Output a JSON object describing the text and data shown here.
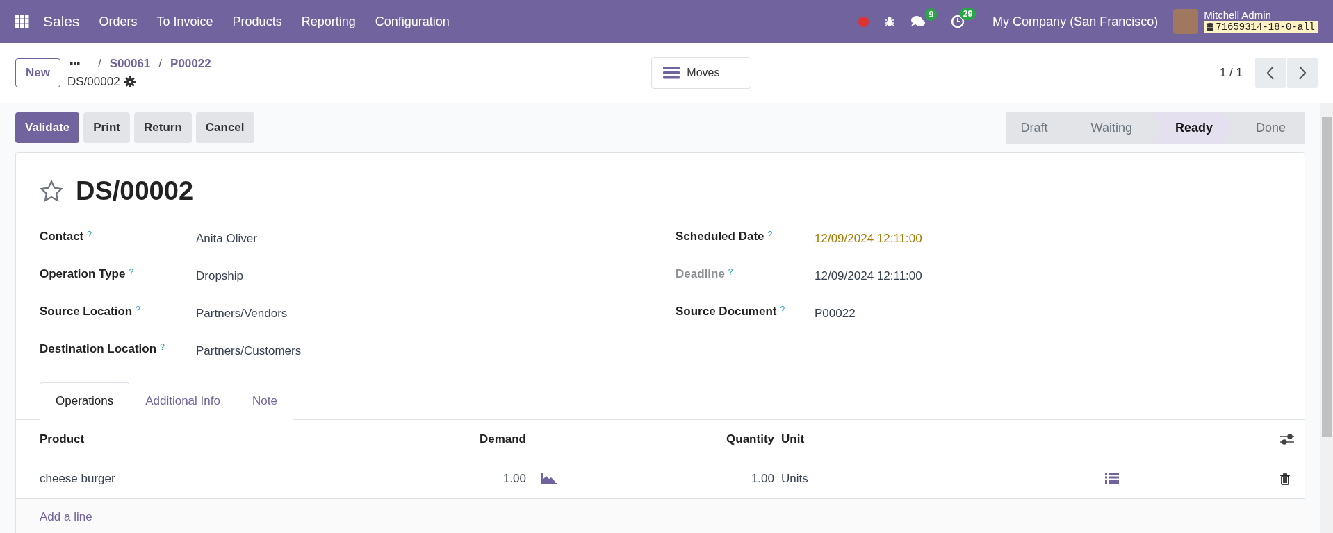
{
  "navbar": {
    "app": "Sales",
    "menus": [
      "Orders",
      "To Invoice",
      "Products",
      "Reporting",
      "Configuration"
    ],
    "messages_count": "9",
    "activities_count": "29",
    "company": "My Company (San Francisco)",
    "user": "Mitchell Admin",
    "database": "71659314-18-0-all"
  },
  "control_panel": {
    "new_button": "New",
    "breadcrumbs": [
      {
        "separator": "/",
        "label": "S00061"
      },
      {
        "separator": "/",
        "label": "P00022"
      }
    ],
    "record": "DS/00002",
    "moves_button": "Moves",
    "pager": "1 / 1"
  },
  "actions": [
    {
      "label": "Validate",
      "kind": "primary"
    },
    {
      "label": "Print",
      "kind": "secondary"
    },
    {
      "label": "Return",
      "kind": "secondary"
    },
    {
      "label": "Cancel",
      "kind": "secondary"
    }
  ],
  "stages": [
    {
      "label": "Draft",
      "selected": false
    },
    {
      "label": "Waiting",
      "selected": false
    },
    {
      "label": "Ready",
      "selected": true
    },
    {
      "label": "Done",
      "selected": false
    }
  ],
  "form": {
    "title": "DS/00002",
    "starred": false,
    "left_fields": [
      {
        "label": "Contact",
        "help": "?",
        "value": "Anita Oliver",
        "muted": false,
        "warning": false
      },
      {
        "label": "Operation Type",
        "help": "?",
        "value": "Dropship",
        "muted": false,
        "warning": false
      },
      {
        "label": "Source Location",
        "help": "?",
        "value": "Partners/Vendors",
        "muted": false,
        "warning": false
      },
      {
        "label": "Destination Location",
        "help": "?",
        "value": "Partners/Customers",
        "muted": false,
        "warning": false
      }
    ],
    "right_fields": [
      {
        "label": "Scheduled Date",
        "help": "?",
        "value": "12/09/2024 12:11:00",
        "muted": false,
        "warning": true
      },
      {
        "label": "Deadline",
        "help": "?",
        "value": "12/09/2024 12:11:00",
        "muted": true,
        "warning": false
      },
      {
        "label": "Source Document",
        "help": "?",
        "value": "P00022",
        "muted": false,
        "warning": false
      }
    ]
  },
  "tabs": [
    {
      "label": "Operations",
      "selected": true
    },
    {
      "label": "Additional Info",
      "selected": false
    },
    {
      "label": "Note",
      "selected": false
    }
  ],
  "table": {
    "columns": [
      "Product",
      "Demand",
      "Quantity",
      "Unit"
    ],
    "rows": [
      {
        "product": "cheese burger",
        "demand": "1.00",
        "quantity": "1.00",
        "unit": "Units"
      }
    ],
    "add_line": "Add a line"
  }
}
